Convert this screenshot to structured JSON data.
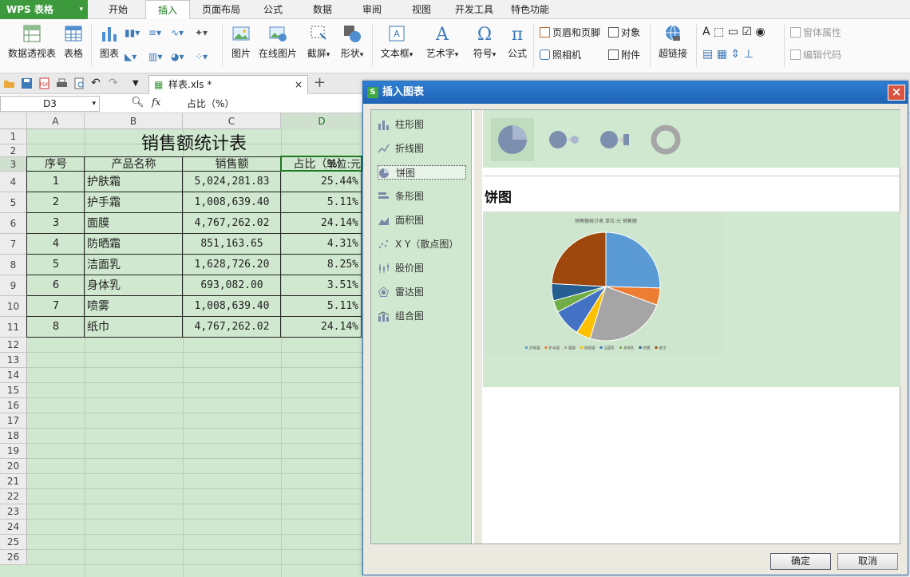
{
  "app": {
    "brand": "WPS 表格",
    "accent": "#3c9a3c"
  },
  "menu": [
    "开始",
    "插入",
    "页面布局",
    "公式",
    "数据",
    "审阅",
    "视图",
    "开发工具",
    "特色功能"
  ],
  "ribbon": {
    "pivot": "数据透视表",
    "table": "表格",
    "chart": "图表",
    "picture": "图片",
    "online_picture": "在线图片",
    "screenshot": "截屏",
    "shape": "形状",
    "textbox": "文本框",
    "wordart": "艺术字",
    "symbol": "符号",
    "formula": "公式",
    "header_footer": "页眉和页脚",
    "object": "对象",
    "camera": "照相机",
    "attachment": "附件",
    "hyperlink": "超链接",
    "control_properties": "窗体属性",
    "edit_code": "编辑代码"
  },
  "document": {
    "tab_name": "样表.xls *",
    "close": "×",
    "new_tab": "+"
  },
  "formula_bar": {
    "name_box": "D3",
    "fx": "fx",
    "value": "占比（%）"
  },
  "sheet": {
    "columns": [
      "A",
      "B",
      "C",
      "D"
    ],
    "rows": [
      "1",
      "2",
      "3",
      "4",
      "5",
      "6",
      "7",
      "8",
      "9",
      "10",
      "11",
      "12",
      "13",
      "14",
      "15",
      "16",
      "17",
      "18",
      "19",
      "20",
      "21",
      "22",
      "23",
      "24",
      "25",
      "26"
    ],
    "title": "销售额统计表",
    "unit": "单位:元",
    "headers": [
      "序号",
      "产品名称",
      "销售额",
      "占比（%）"
    ],
    "data": [
      [
        "1",
        "护肤霜",
        "5,024,281.83",
        "25.44%"
      ],
      [
        "2",
        "护手霜",
        "1,008,639.40",
        "5.11%"
      ],
      [
        "3",
        "面膜",
        "4,767,262.02",
        "24.14%"
      ],
      [
        "4",
        "防晒霜",
        "851,163.65",
        "4.31%"
      ],
      [
        "5",
        "洁面乳",
        "1,628,726.20",
        "8.25%"
      ],
      [
        "6",
        "身体乳",
        "693,082.00",
        "3.51%"
      ],
      [
        "7",
        "喷雾",
        "1,008,639.40",
        "5.11%"
      ],
      [
        "8",
        "纸巾",
        "4,767,262.02",
        "24.14%"
      ]
    ]
  },
  "dialog": {
    "title": "插入图表",
    "close": "×",
    "chart_types": [
      "柱形图",
      "折线图",
      "饼图",
      "条形图",
      "面积图",
      "X Y（散点图）",
      "股价图",
      "雷达图",
      "组合图"
    ],
    "selected_type": "饼图",
    "preview_title": "饼图",
    "ok": "确定",
    "cancel": "取消"
  },
  "chart_data": {
    "type": "pie",
    "title": "销售额统计表 单位:元 销售额",
    "categories": [
      "护肤霜",
      "护手霜",
      "面膜",
      "防晒霜",
      "洁面乳",
      "身体乳",
      "喷雾",
      "纸巾"
    ],
    "values": [
      5024281.83,
      1008639.4,
      4767262.02,
      851163.65,
      1628726.2,
      693082.0,
      1008639.4,
      4767262.02
    ],
    "colors": [
      "#5b9bd5",
      "#ed7d31",
      "#a5a5a5",
      "#ffc000",
      "#4472c4",
      "#70ad47",
      "#255e91",
      "#9e480e"
    ],
    "legend_position": "bottom"
  }
}
